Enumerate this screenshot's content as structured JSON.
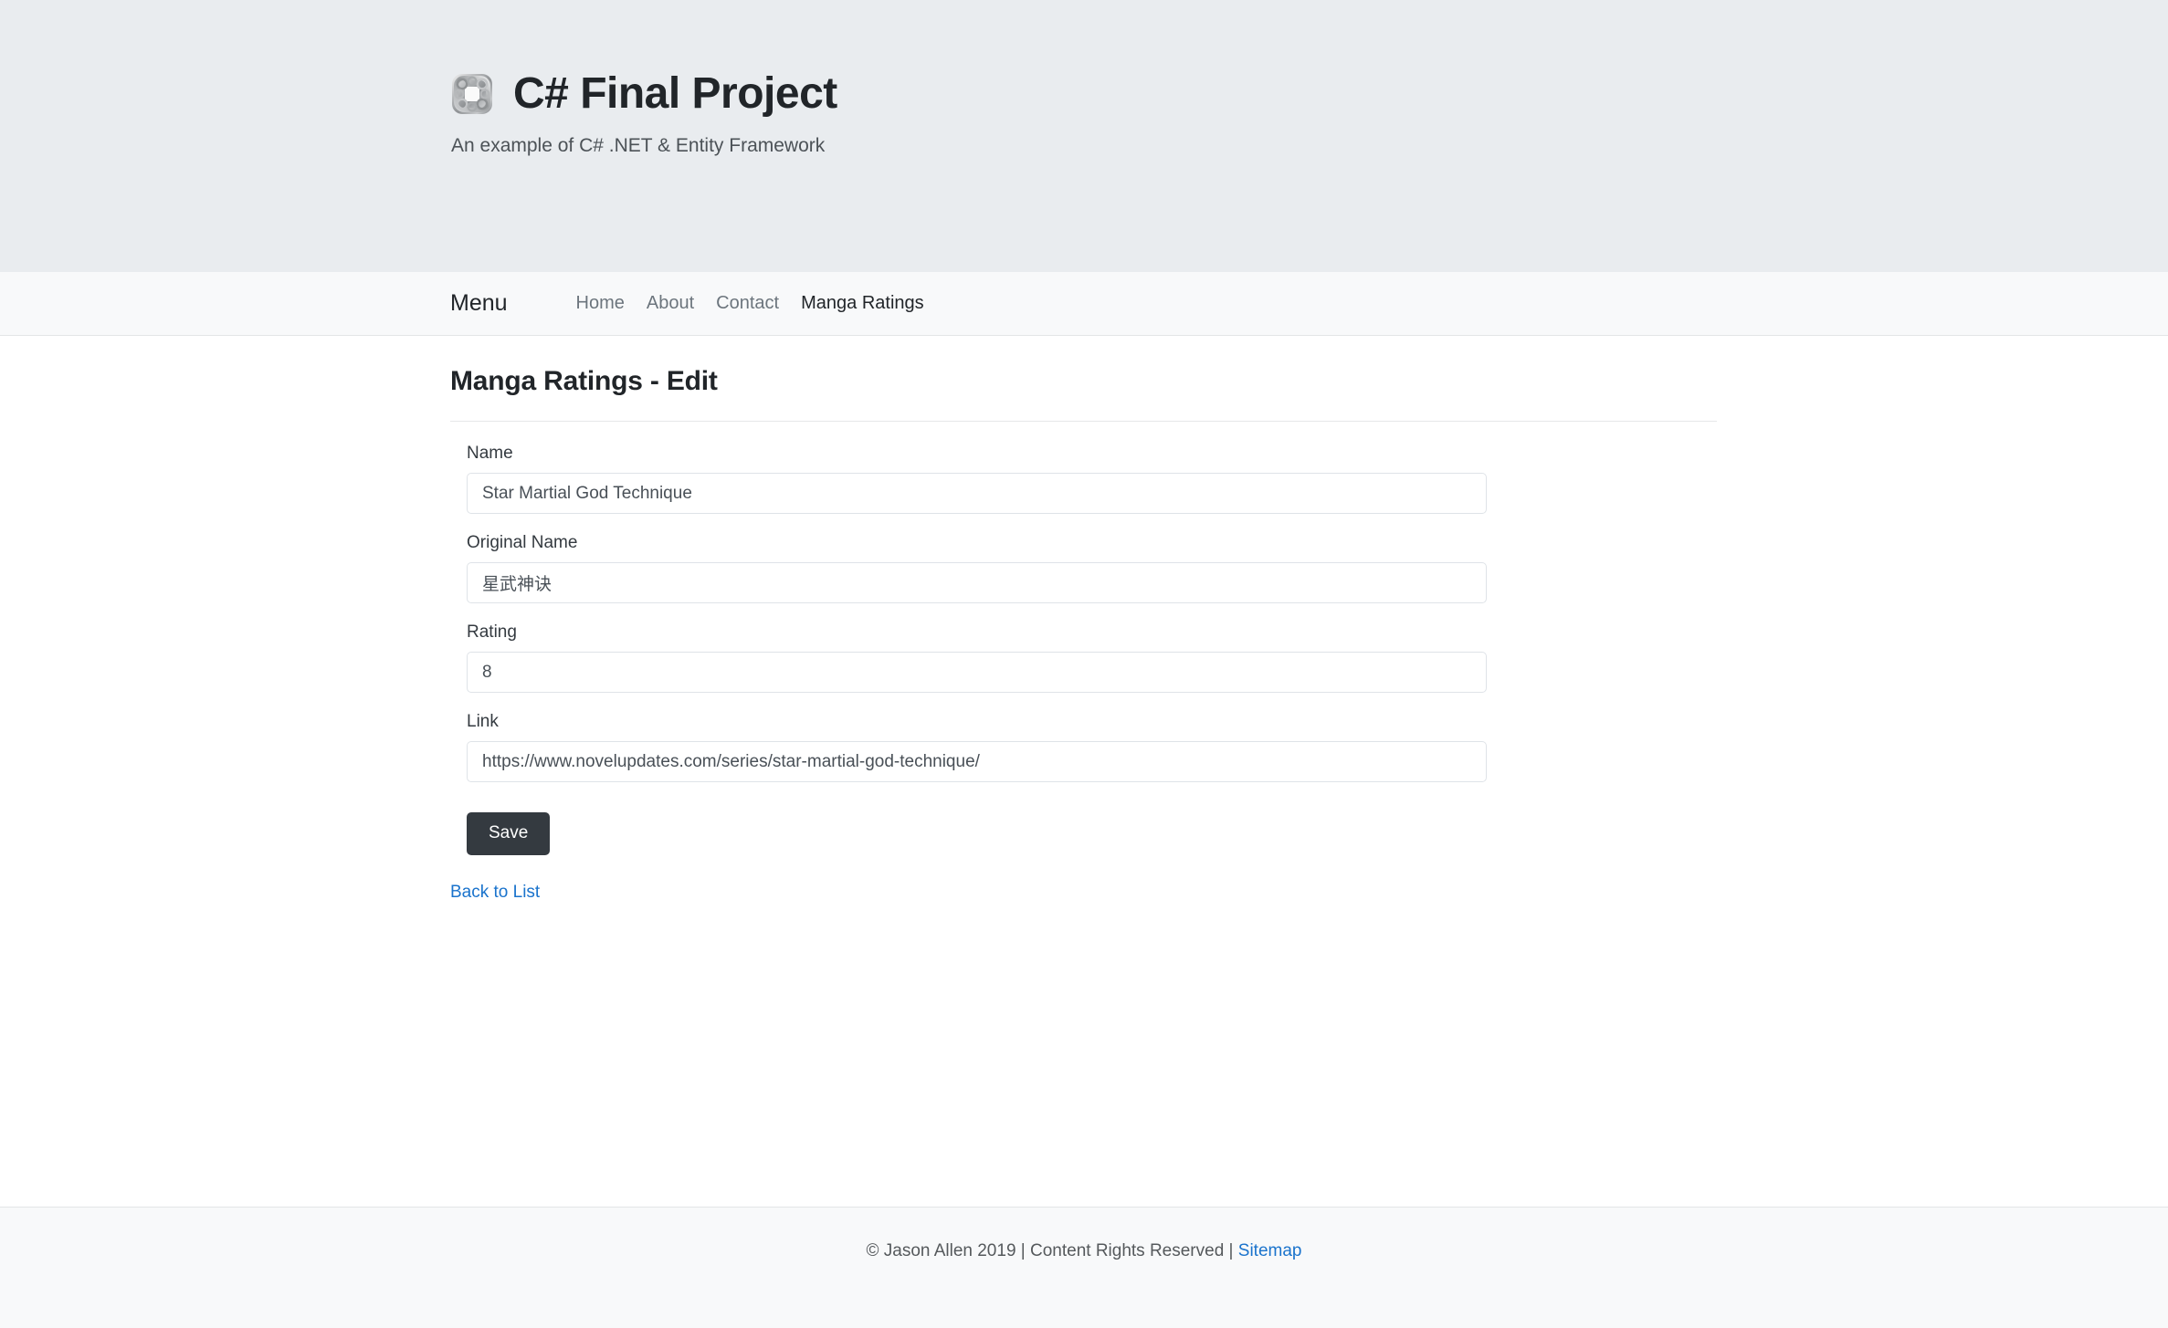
{
  "masthead": {
    "logo_icon": "interlocking-rings-logo",
    "title": "C# Final Project",
    "subtitle": "An example of C# .NET & Entity Framework",
    "background_color": "#e9ecef"
  },
  "navbar": {
    "brand": "Menu",
    "items": [
      {
        "label": "Home",
        "active": false
      },
      {
        "label": "About",
        "active": false
      },
      {
        "label": "Contact",
        "active": false
      },
      {
        "label": "Manga Ratings",
        "active": true
      }
    ],
    "background_color": "#f8f9fa",
    "muted_color": "#6c757d",
    "active_color": "#212529"
  },
  "main": {
    "page_title": "Manga Ratings - Edit",
    "form": {
      "fields": [
        {
          "label": "Name",
          "value": "Star Martial God Technique",
          "placeholder": "Name",
          "type": "text"
        },
        {
          "label": "Original Name",
          "value": "星武神诀",
          "placeholder": "Original Name",
          "type": "text"
        },
        {
          "label": "Rating",
          "value": "8",
          "placeholder": "Rating",
          "type": "text"
        },
        {
          "label": "Link",
          "value": "https://www.novelupdates.com/series/star-martial-god-technique/",
          "placeholder": "Link",
          "type": "text"
        }
      ],
      "save_label": "Save",
      "save_button_color": "#343a40"
    },
    "back_link": "Back to List",
    "link_color": "#1a73cc"
  },
  "footer": {
    "text": "© Jason Allen 2019 | Content Rights Reserved | ",
    "sitemap_label": "Sitemap",
    "background_color": "#f8f9fa"
  }
}
